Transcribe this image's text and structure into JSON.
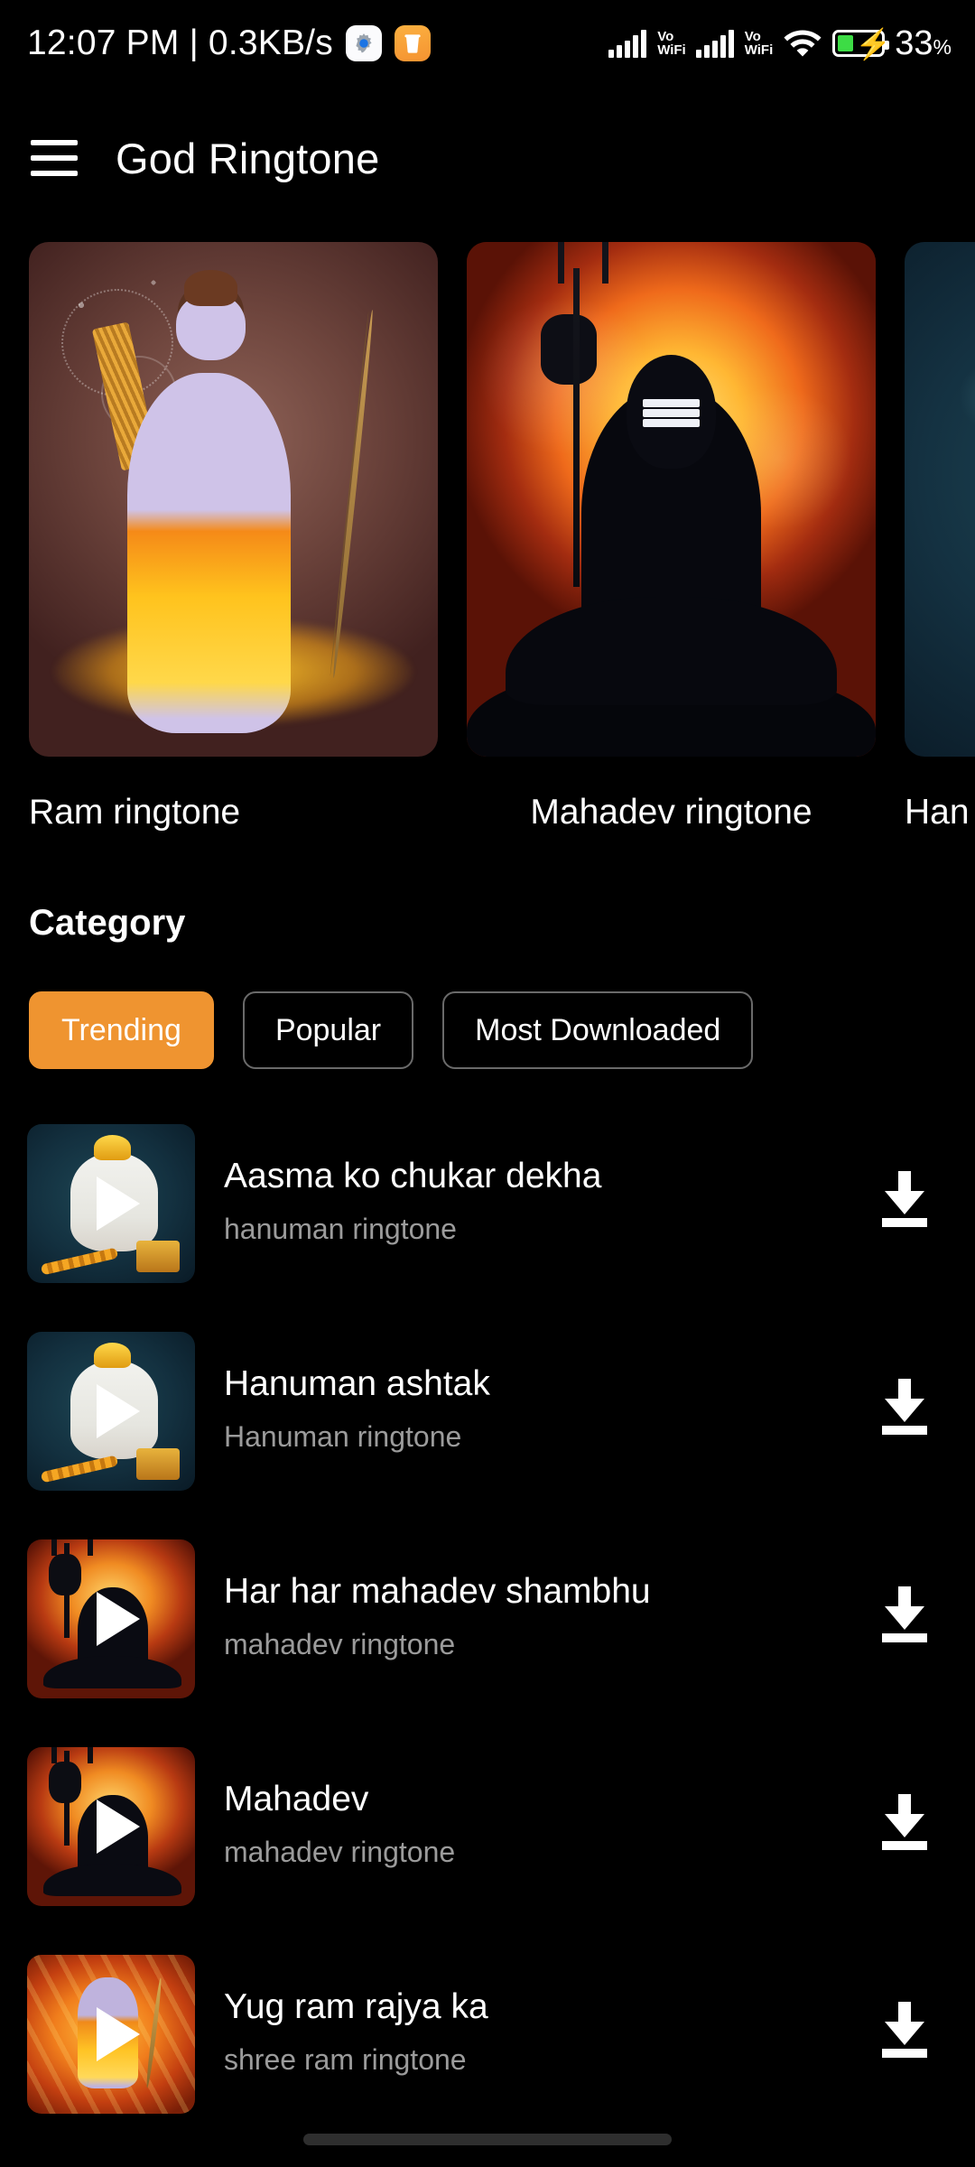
{
  "statusbar": {
    "clock": "12:07 PM | 0.3KB/s",
    "settings_icon": "gear-icon",
    "cleaner_icon": "trash-icon",
    "signal1_label": "Vo\nWiFi",
    "signal2_label": "Vo\nWiFi",
    "wifi_icon": "wifi-icon",
    "battery_percent": "33",
    "battery_percent_symbol": "%",
    "battery_level": 33,
    "battery_charging": true
  },
  "appbar": {
    "menu_icon": "hamburger-menu-icon",
    "title": "God Ringtone"
  },
  "carousel": {
    "cards": [
      {
        "label": "Ram ringtone",
        "art": "ram"
      },
      {
        "label": "Mahadev ringtone",
        "art": "mahadev"
      },
      {
        "label": "Han",
        "art": "hanuman"
      }
    ]
  },
  "category": {
    "heading": "Category",
    "chips": [
      {
        "label": "Trending",
        "active": true
      },
      {
        "label": "Popular",
        "active": false
      },
      {
        "label": "Most Downloaded",
        "active": false
      }
    ],
    "active_color": "#ef9430"
  },
  "list": {
    "items": [
      {
        "title": "Aasma ko chukar dekha",
        "subtitle": "hanuman ringtone",
        "thumb": "hanuman",
        "play_icon": "play-icon",
        "download_icon": "download-icon"
      },
      {
        "title": "Hanuman ashtak",
        "subtitle": "Hanuman ringtone",
        "thumb": "hanuman",
        "play_icon": "play-icon",
        "download_icon": "download-icon"
      },
      {
        "title": "Har har mahadev shambhu",
        "subtitle": "mahadev ringtone",
        "thumb": "mahadev",
        "play_icon": "play-icon",
        "download_icon": "download-icon"
      },
      {
        "title": "Mahadev",
        "subtitle": "mahadev ringtone",
        "thumb": "mahadev",
        "play_icon": "play-icon",
        "download_icon": "download-icon"
      },
      {
        "title": "Yug ram rajya ka",
        "subtitle": "shree ram ringtone",
        "thumb": "ram",
        "play_icon": "play-icon",
        "download_icon": "download-icon"
      }
    ]
  },
  "navigation": {
    "gesture_bar": "home-gesture-bar"
  }
}
